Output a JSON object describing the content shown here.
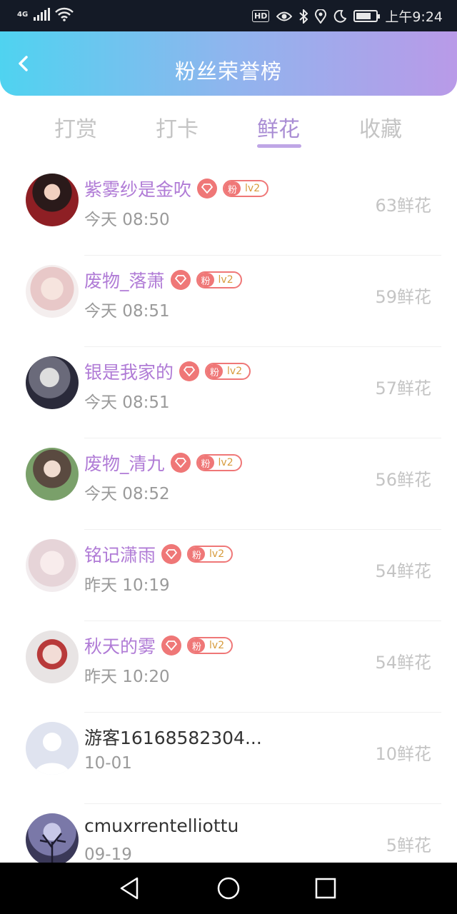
{
  "statusbar": {
    "network": "4G",
    "hd": "HD",
    "time": "上午9:24"
  },
  "header": {
    "title": "粉丝荣誉榜"
  },
  "tabs": [
    {
      "label": "打赏",
      "active": false
    },
    {
      "label": "打卡",
      "active": false
    },
    {
      "label": "鲜花",
      "active": true
    },
    {
      "label": "收藏",
      "active": false
    }
  ],
  "fans": [
    {
      "name": "紫雾纱是金吹",
      "time": "今天 08:50",
      "count": "63鲜花",
      "vip": true,
      "badge_fan": "粉",
      "badge_level": "lv2"
    },
    {
      "name": "废物_落萧",
      "time": "今天 08:51",
      "count": "59鲜花",
      "vip": true,
      "badge_fan": "粉",
      "badge_level": "lv2"
    },
    {
      "name": "银是我家的",
      "time": "今天 08:51",
      "count": "57鲜花",
      "vip": true,
      "badge_fan": "粉",
      "badge_level": "lv2"
    },
    {
      "name": "废物_清九",
      "time": "今天 08:52",
      "count": "56鲜花",
      "vip": true,
      "badge_fan": "粉",
      "badge_level": "lv2"
    },
    {
      "name": "铭记潇雨",
      "time": "昨天 10:19",
      "count": "54鲜花",
      "vip": true,
      "badge_fan": "粉",
      "badge_level": "lv2"
    },
    {
      "name": "秋天的雾",
      "time": "昨天 10:20",
      "count": "54鲜花",
      "vip": true,
      "badge_fan": "粉",
      "badge_level": "lv2"
    },
    {
      "name": "游客16168582304...",
      "time": "10-01",
      "count": "10鲜花",
      "vip": false
    },
    {
      "name": "cmuxrrentelliottu",
      "time": "09-19",
      "count": "5鲜花",
      "vip": false
    }
  ],
  "colors": {
    "accent": "#b07bd6",
    "badge": "#ef7777",
    "header_start": "#4fd3f0",
    "header_end": "#b99ae8"
  }
}
